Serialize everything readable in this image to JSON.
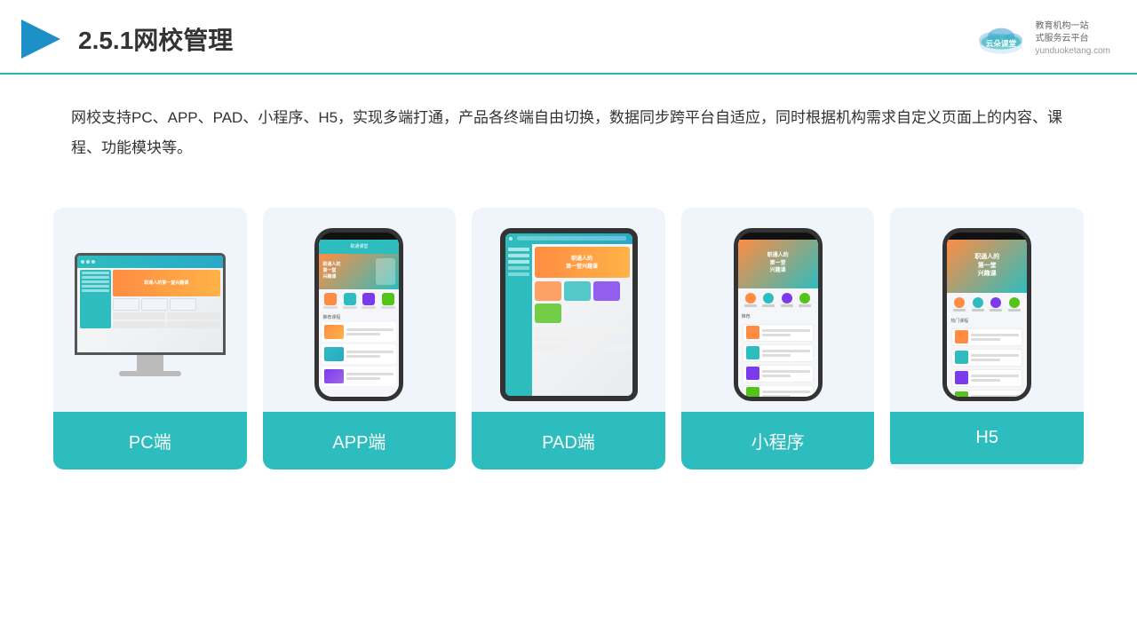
{
  "header": {
    "title": "2.5.1网校管理",
    "logo_name": "云朵课堂",
    "logo_url": "yunduoketang.com",
    "logo_slogan": "教育机构一站\n式服务云平台"
  },
  "description": {
    "text": "网校支持PC、APP、PAD、小程序、H5，实现多端打通，产品各终端自由切换，数据同步跨平台自适应，同时根据机构需求自定义页面上的内容、课程、功能模块等。"
  },
  "cards": [
    {
      "id": "pc",
      "label": "PC端"
    },
    {
      "id": "app",
      "label": "APP端"
    },
    {
      "id": "pad",
      "label": "PAD端"
    },
    {
      "id": "miniprogram",
      "label": "小程序"
    },
    {
      "id": "h5",
      "label": "H5"
    }
  ],
  "colors": {
    "accent": "#2dbdbe",
    "header_border": "#2cb5b5",
    "card_bg": "#f0f4fb",
    "card_label_bg": "#2dbdbe"
  }
}
